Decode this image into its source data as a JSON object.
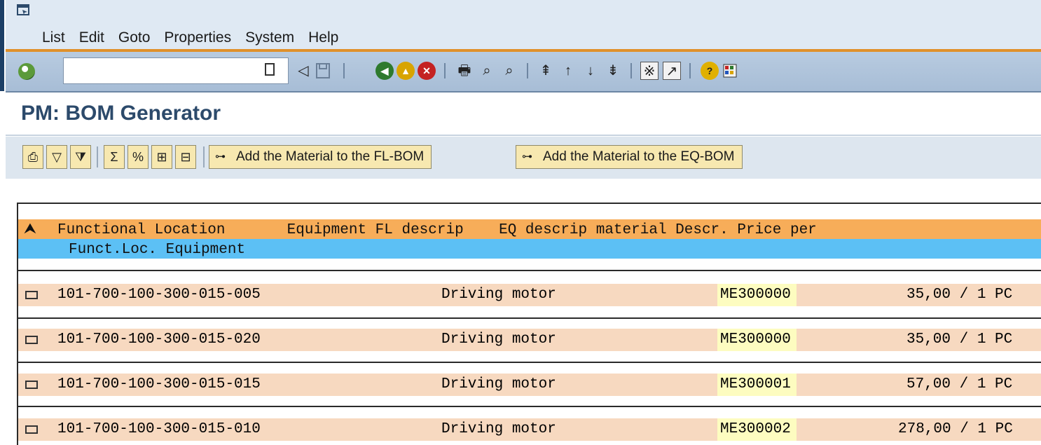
{
  "menu": {
    "items": [
      "List",
      "Edit",
      "Goto",
      "Properties",
      "System",
      "Help"
    ]
  },
  "toolbar": {
    "command_value": ""
  },
  "page": {
    "title": "PM: BOM Generator"
  },
  "app_toolbar": {
    "add_fl_bom": "Add the Material to the FL-BOM",
    "add_eq_bom": "Add the Material to the EQ-BOM"
  },
  "list": {
    "header1": "Functional Location       Equipment FL descrip    EQ descrip material Descr. Price per",
    "header2": "Funct.Loc. Equipment",
    "rows": [
      {
        "fl": "101-700-100-300-015-005",
        "fl_descrip": "Driving motor",
        "material": "ME300000",
        "price": "35,00 / 1 PC"
      },
      {
        "fl": "101-700-100-300-015-020",
        "fl_descrip": "Driving motor",
        "material": "ME300000",
        "price": "35,00 / 1 PC"
      },
      {
        "fl": "101-700-100-300-015-015",
        "fl_descrip": "Driving motor",
        "material": "ME300001",
        "price": "57,00 / 1 PC"
      },
      {
        "fl": "101-700-100-300-015-010",
        "fl_descrip": "Driving motor",
        "material": "ME300002",
        "price": "278,00 / 1 PC"
      }
    ]
  },
  "colors": {
    "header_orange": "#f7ad59",
    "header_blue": "#5cc0f5",
    "row_bg": "#f7d9c0",
    "material_bg": "#fdfcc0",
    "title_color": "#2c4a6b"
  }
}
